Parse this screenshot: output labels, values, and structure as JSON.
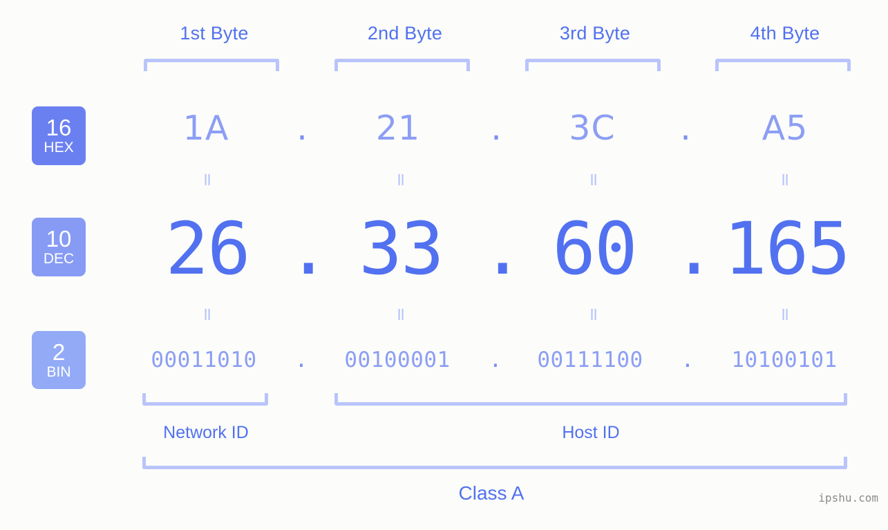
{
  "header": {
    "byte_labels": [
      "1st Byte",
      "2nd Byte",
      "3rd Byte",
      "4th Byte"
    ]
  },
  "bases": [
    {
      "number": "16",
      "name": "HEX",
      "color": "#6b80f0"
    },
    {
      "number": "10",
      "name": "DEC",
      "color": "#879bf4"
    },
    {
      "number": "2",
      "name": "BIN",
      "color": "#93abf6"
    }
  ],
  "rows": {
    "hex": {
      "label": "HEX",
      "octets": [
        "1A",
        "21",
        "3C",
        "A5"
      ],
      "separator": "."
    },
    "dec": {
      "label": "DEC",
      "octets": [
        "26",
        "33",
        "60",
        "165"
      ],
      "separator": "."
    },
    "bin": {
      "label": "BIN",
      "octets": [
        "00011010",
        "00100001",
        "00111100",
        "10100101"
      ],
      "separator": "."
    }
  },
  "equals_symbol": "=",
  "footer": {
    "network_id_label": "Network ID",
    "host_id_label": "Host ID",
    "class_label": "Class A",
    "watermark": "ipshu.com"
  },
  "colors": {
    "background": "#fcfdfa",
    "accent_strong": "#5271f0",
    "accent_mid": "#8c9ef4",
    "accent_light": "#b9c4fb",
    "watermark": "#8b8b8b"
  }
}
